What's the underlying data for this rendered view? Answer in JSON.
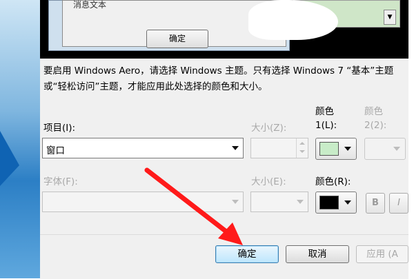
{
  "preview": {
    "message_text": "消息文本",
    "ok_label": "确定",
    "scroll_glyph": "▼"
  },
  "description": "要启用 Windows Aero，请选择 Windows 主题。只有选择 Windows 7 “基本”主题或“轻松访问”主题，才能应用此处选择的颜色和大小。",
  "item": {
    "label": "项目(I):",
    "value": "窗口"
  },
  "size1": {
    "label": "大小(Z):",
    "value": ""
  },
  "color1": {
    "label_line1": "颜色",
    "label_line2": "1(L):",
    "swatch": "#c8ecc8"
  },
  "color2": {
    "label_line1": "颜色",
    "label_line2": "2(2):"
  },
  "font": {
    "label": "字体(F):",
    "value": ""
  },
  "size2": {
    "label": "大小(E):",
    "value": ""
  },
  "font_color": {
    "label": "颜色(R):",
    "swatch": "#000000"
  },
  "format": {
    "bold_label": "B",
    "italic_label": "I"
  },
  "buttons": {
    "ok": "确定",
    "cancel": "取消",
    "apply": "应用 (A"
  },
  "colors": {
    "arrow": "#ff1a1a",
    "primary_border": "#3c7fb1"
  }
}
